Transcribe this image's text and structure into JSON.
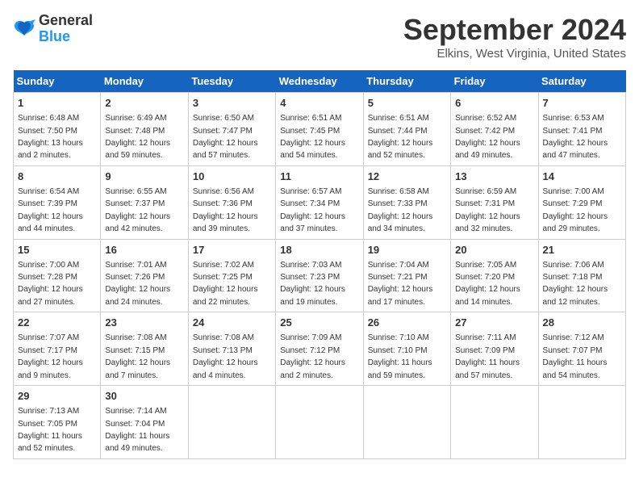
{
  "logo": {
    "line1": "General",
    "line2": "Blue"
  },
  "title": "September 2024",
  "location": "Elkins, West Virginia, United States",
  "weekdays": [
    "Sunday",
    "Monday",
    "Tuesday",
    "Wednesday",
    "Thursday",
    "Friday",
    "Saturday"
  ],
  "weeks": [
    [
      {
        "day": "1",
        "sunrise": "6:48 AM",
        "sunset": "7:50 PM",
        "daylight": "13 hours and 2 minutes."
      },
      {
        "day": "2",
        "sunrise": "6:49 AM",
        "sunset": "7:48 PM",
        "daylight": "12 hours and 59 minutes."
      },
      {
        "day": "3",
        "sunrise": "6:50 AM",
        "sunset": "7:47 PM",
        "daylight": "12 hours and 57 minutes."
      },
      {
        "day": "4",
        "sunrise": "6:51 AM",
        "sunset": "7:45 PM",
        "daylight": "12 hours and 54 minutes."
      },
      {
        "day": "5",
        "sunrise": "6:51 AM",
        "sunset": "7:44 PM",
        "daylight": "12 hours and 52 minutes."
      },
      {
        "day": "6",
        "sunrise": "6:52 AM",
        "sunset": "7:42 PM",
        "daylight": "12 hours and 49 minutes."
      },
      {
        "day": "7",
        "sunrise": "6:53 AM",
        "sunset": "7:41 PM",
        "daylight": "12 hours and 47 minutes."
      }
    ],
    [
      {
        "day": "8",
        "sunrise": "6:54 AM",
        "sunset": "7:39 PM",
        "daylight": "12 hours and 44 minutes."
      },
      {
        "day": "9",
        "sunrise": "6:55 AM",
        "sunset": "7:37 PM",
        "daylight": "12 hours and 42 minutes."
      },
      {
        "day": "10",
        "sunrise": "6:56 AM",
        "sunset": "7:36 PM",
        "daylight": "12 hours and 39 minutes."
      },
      {
        "day": "11",
        "sunrise": "6:57 AM",
        "sunset": "7:34 PM",
        "daylight": "12 hours and 37 minutes."
      },
      {
        "day": "12",
        "sunrise": "6:58 AM",
        "sunset": "7:33 PM",
        "daylight": "12 hours and 34 minutes."
      },
      {
        "day": "13",
        "sunrise": "6:59 AM",
        "sunset": "7:31 PM",
        "daylight": "12 hours and 32 minutes."
      },
      {
        "day": "14",
        "sunrise": "7:00 AM",
        "sunset": "7:29 PM",
        "daylight": "12 hours and 29 minutes."
      }
    ],
    [
      {
        "day": "15",
        "sunrise": "7:00 AM",
        "sunset": "7:28 PM",
        "daylight": "12 hours and 27 minutes."
      },
      {
        "day": "16",
        "sunrise": "7:01 AM",
        "sunset": "7:26 PM",
        "daylight": "12 hours and 24 minutes."
      },
      {
        "day": "17",
        "sunrise": "7:02 AM",
        "sunset": "7:25 PM",
        "daylight": "12 hours and 22 minutes."
      },
      {
        "day": "18",
        "sunrise": "7:03 AM",
        "sunset": "7:23 PM",
        "daylight": "12 hours and 19 minutes."
      },
      {
        "day": "19",
        "sunrise": "7:04 AM",
        "sunset": "7:21 PM",
        "daylight": "12 hours and 17 minutes."
      },
      {
        "day": "20",
        "sunrise": "7:05 AM",
        "sunset": "7:20 PM",
        "daylight": "12 hours and 14 minutes."
      },
      {
        "day": "21",
        "sunrise": "7:06 AM",
        "sunset": "7:18 PM",
        "daylight": "12 hours and 12 minutes."
      }
    ],
    [
      {
        "day": "22",
        "sunrise": "7:07 AM",
        "sunset": "7:17 PM",
        "daylight": "12 hours and 9 minutes."
      },
      {
        "day": "23",
        "sunrise": "7:08 AM",
        "sunset": "7:15 PM",
        "daylight": "12 hours and 7 minutes."
      },
      {
        "day": "24",
        "sunrise": "7:08 AM",
        "sunset": "7:13 PM",
        "daylight": "12 hours and 4 minutes."
      },
      {
        "day": "25",
        "sunrise": "7:09 AM",
        "sunset": "7:12 PM",
        "daylight": "12 hours and 2 minutes."
      },
      {
        "day": "26",
        "sunrise": "7:10 AM",
        "sunset": "7:10 PM",
        "daylight": "11 hours and 59 minutes."
      },
      {
        "day": "27",
        "sunrise": "7:11 AM",
        "sunset": "7:09 PM",
        "daylight": "11 hours and 57 minutes."
      },
      {
        "day": "28",
        "sunrise": "7:12 AM",
        "sunset": "7:07 PM",
        "daylight": "11 hours and 54 minutes."
      }
    ],
    [
      {
        "day": "29",
        "sunrise": "7:13 AM",
        "sunset": "7:05 PM",
        "daylight": "11 hours and 52 minutes."
      },
      {
        "day": "30",
        "sunrise": "7:14 AM",
        "sunset": "7:04 PM",
        "daylight": "11 hours and 49 minutes."
      },
      null,
      null,
      null,
      null,
      null
    ]
  ]
}
